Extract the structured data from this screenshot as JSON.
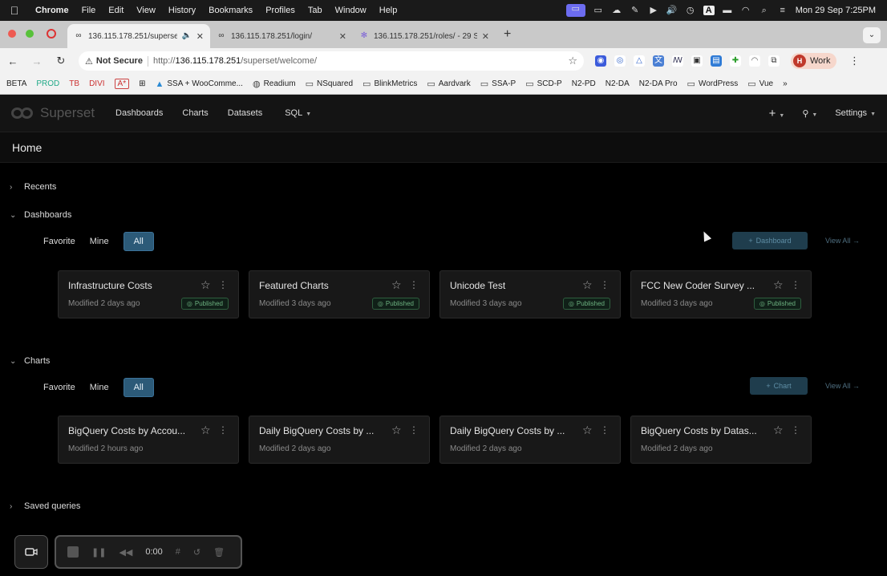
{
  "menubar": {
    "app": "Chrome",
    "items": [
      "File",
      "Edit",
      "View",
      "History",
      "Bookmarks",
      "Profiles",
      "Tab",
      "Window",
      "Help"
    ],
    "datetime": "Mon 29 Sep  7:25PM",
    "input_source": "A"
  },
  "tabs": [
    {
      "label": "136.115.178.251/superset",
      "active": true
    },
    {
      "label": "136.115.178.251/login/",
      "active": false
    },
    {
      "label": "136.115.178.251/roles/ - 29 Sep",
      "active": false
    }
  ],
  "toolbar": {
    "not_secure": "Not Secure",
    "url_scheme": "http://",
    "url_host": "136.115.178.251",
    "url_path": "/superset/welcome/",
    "profile_initial": "H",
    "profile_name": "Work"
  },
  "bookmarks": [
    "BETA",
    "PROD",
    "TB",
    "DIVI",
    "A*",
    "SSA + WooComme...",
    "Readium",
    "NSquared",
    "BlinkMetrics",
    "Aardvark",
    "SSA-P",
    "SCD-P",
    "N2-PD",
    "N2-DA",
    "N2-DA Pro",
    "WordPress",
    "Vue"
  ],
  "app": {
    "brand": "Superset",
    "nav": [
      "Dashboards",
      "Charts",
      "Datasets",
      "SQL"
    ],
    "settings": "Settings",
    "page_title": "Home"
  },
  "sections": {
    "recents": "Recents",
    "dashboards": "Dashboards",
    "charts": "Charts",
    "saved_queries": "Saved queries"
  },
  "filters": {
    "favorite": "Favorite",
    "mine": "Mine",
    "all": "All"
  },
  "dashboards": {
    "add_label": "Dashboard",
    "view_all": "View All",
    "cards": [
      {
        "title": "Infrastructure Costs",
        "modified": "Modified 2 days ago",
        "status": "Published"
      },
      {
        "title": "Featured Charts",
        "modified": "Modified 3 days ago",
        "status": "Published"
      },
      {
        "title": "Unicode Test",
        "modified": "Modified 3 days ago",
        "status": "Published"
      },
      {
        "title": "FCC New Coder Survey ...",
        "modified": "Modified 3 days ago",
        "status": "Published"
      }
    ]
  },
  "charts": {
    "add_label": "Chart",
    "view_all": "View All",
    "cards": [
      {
        "title": "BigQuery Costs by Accou...",
        "modified": "Modified 2 hours ago"
      },
      {
        "title": "Daily BigQuery Costs by ...",
        "modified": "Modified 2 days ago"
      },
      {
        "title": "Daily BigQuery Costs by ...",
        "modified": "Modified 2 days ago"
      },
      {
        "title": "BigQuery Costs by Datas...",
        "modified": "Modified 2 days ago"
      }
    ]
  },
  "recorder": {
    "time": "0:00"
  }
}
